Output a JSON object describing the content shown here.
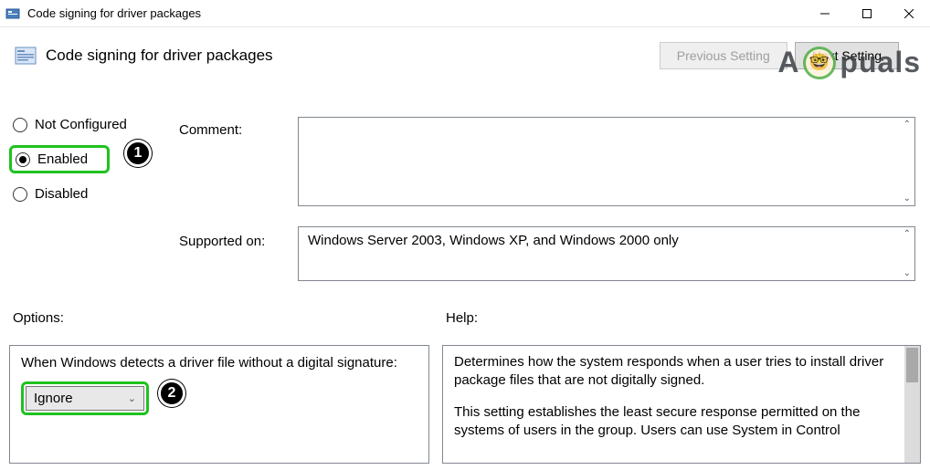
{
  "titlebar": {
    "title": "Code signing for driver packages"
  },
  "header": {
    "title": "Code signing for driver packages",
    "prev_btn": "Previous Setting",
    "next_btn": "Next Setting"
  },
  "watermark": {
    "text_a": "A",
    "text_rest": "puals"
  },
  "radios": {
    "not_configured": "Not Configured",
    "enabled": "Enabled",
    "disabled": "Disabled"
  },
  "callouts": {
    "one": "1",
    "two": "2"
  },
  "labels": {
    "comment": "Comment:",
    "supported": "Supported on:",
    "options": "Options:",
    "help": "Help:"
  },
  "supported_text": "Windows Server 2003, Windows XP, and Windows 2000 only",
  "options_panel": {
    "question": "When Windows detects a driver file without a digital signature:",
    "dropdown_value": "Ignore"
  },
  "help_panel": {
    "p1": "Determines how the system responds when a user tries to install driver package files that are not digitally signed.",
    "p2": "This setting establishes the least secure response permitted on the systems of users in the group. Users can use System in Control"
  }
}
